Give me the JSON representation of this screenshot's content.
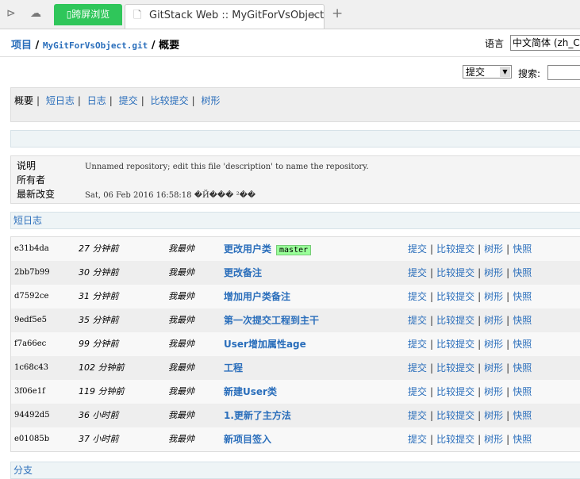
{
  "browser": {
    "green_tab": "跨屏浏览",
    "tab_title": "GitStack Web :: MyGitForVsObject.git",
    "close": "×",
    "new_tab": "+"
  },
  "breadcrumb": {
    "root": "项目",
    "repo": "MyGitForVsObject.git",
    "current": "概要",
    "sep": "/"
  },
  "language": {
    "label": "语言",
    "value": "中文简体 (zh_CN)"
  },
  "search": {
    "type": "提交",
    "label": "搜索:",
    "value": ""
  },
  "nav": [
    "概要",
    "短日志",
    "日志",
    "提交",
    "比较提交",
    "树形"
  ],
  "info": [
    {
      "key": "说明",
      "value": "Unnamed repository; edit this file 'description' to name the repository."
    },
    {
      "key": "所有者",
      "value": ""
    },
    {
      "key": "最新改变",
      "value": "Sat, 06 Feb 2016 16:58:18 �Й���  ²��"
    }
  ],
  "shortlog_title": "短日志",
  "link_labels": [
    "提交",
    "比较提交",
    "树形",
    "快照"
  ],
  "commits": [
    {
      "hash": "e31b4da",
      "age": "27 分钟前",
      "author": "我最帅",
      "message": "更改用户类",
      "badge": "master"
    },
    {
      "hash": "2bb7b99",
      "age": "30 分钟前",
      "author": "我最帅",
      "message": "更改备注"
    },
    {
      "hash": "d7592ce",
      "age": "31 分钟前",
      "author": "我最帅",
      "message": "增加用户类备注"
    },
    {
      "hash": "9edf5e5",
      "age": "35 分钟前",
      "author": "我最帅",
      "message": "第一次提交工程到主干"
    },
    {
      "hash": "f7a66ec",
      "age": "99 分钟前",
      "author": "我最帅",
      "message": "User增加属性age"
    },
    {
      "hash": "1c68c43",
      "age": "102 分钟前",
      "author": "我最帅",
      "message": "工程"
    },
    {
      "hash": "3f06e1f",
      "age": "119 分钟前",
      "author": "我最帅",
      "message": "新建User类"
    },
    {
      "hash": "94492d5",
      "age": "36 小时前",
      "author": "我最帅",
      "message": "1.更新了主方法"
    },
    {
      "hash": "e01085b",
      "age": "37 小时前",
      "author": "我最帅",
      "message": "新项目签入"
    }
  ],
  "branches_title": "分支"
}
